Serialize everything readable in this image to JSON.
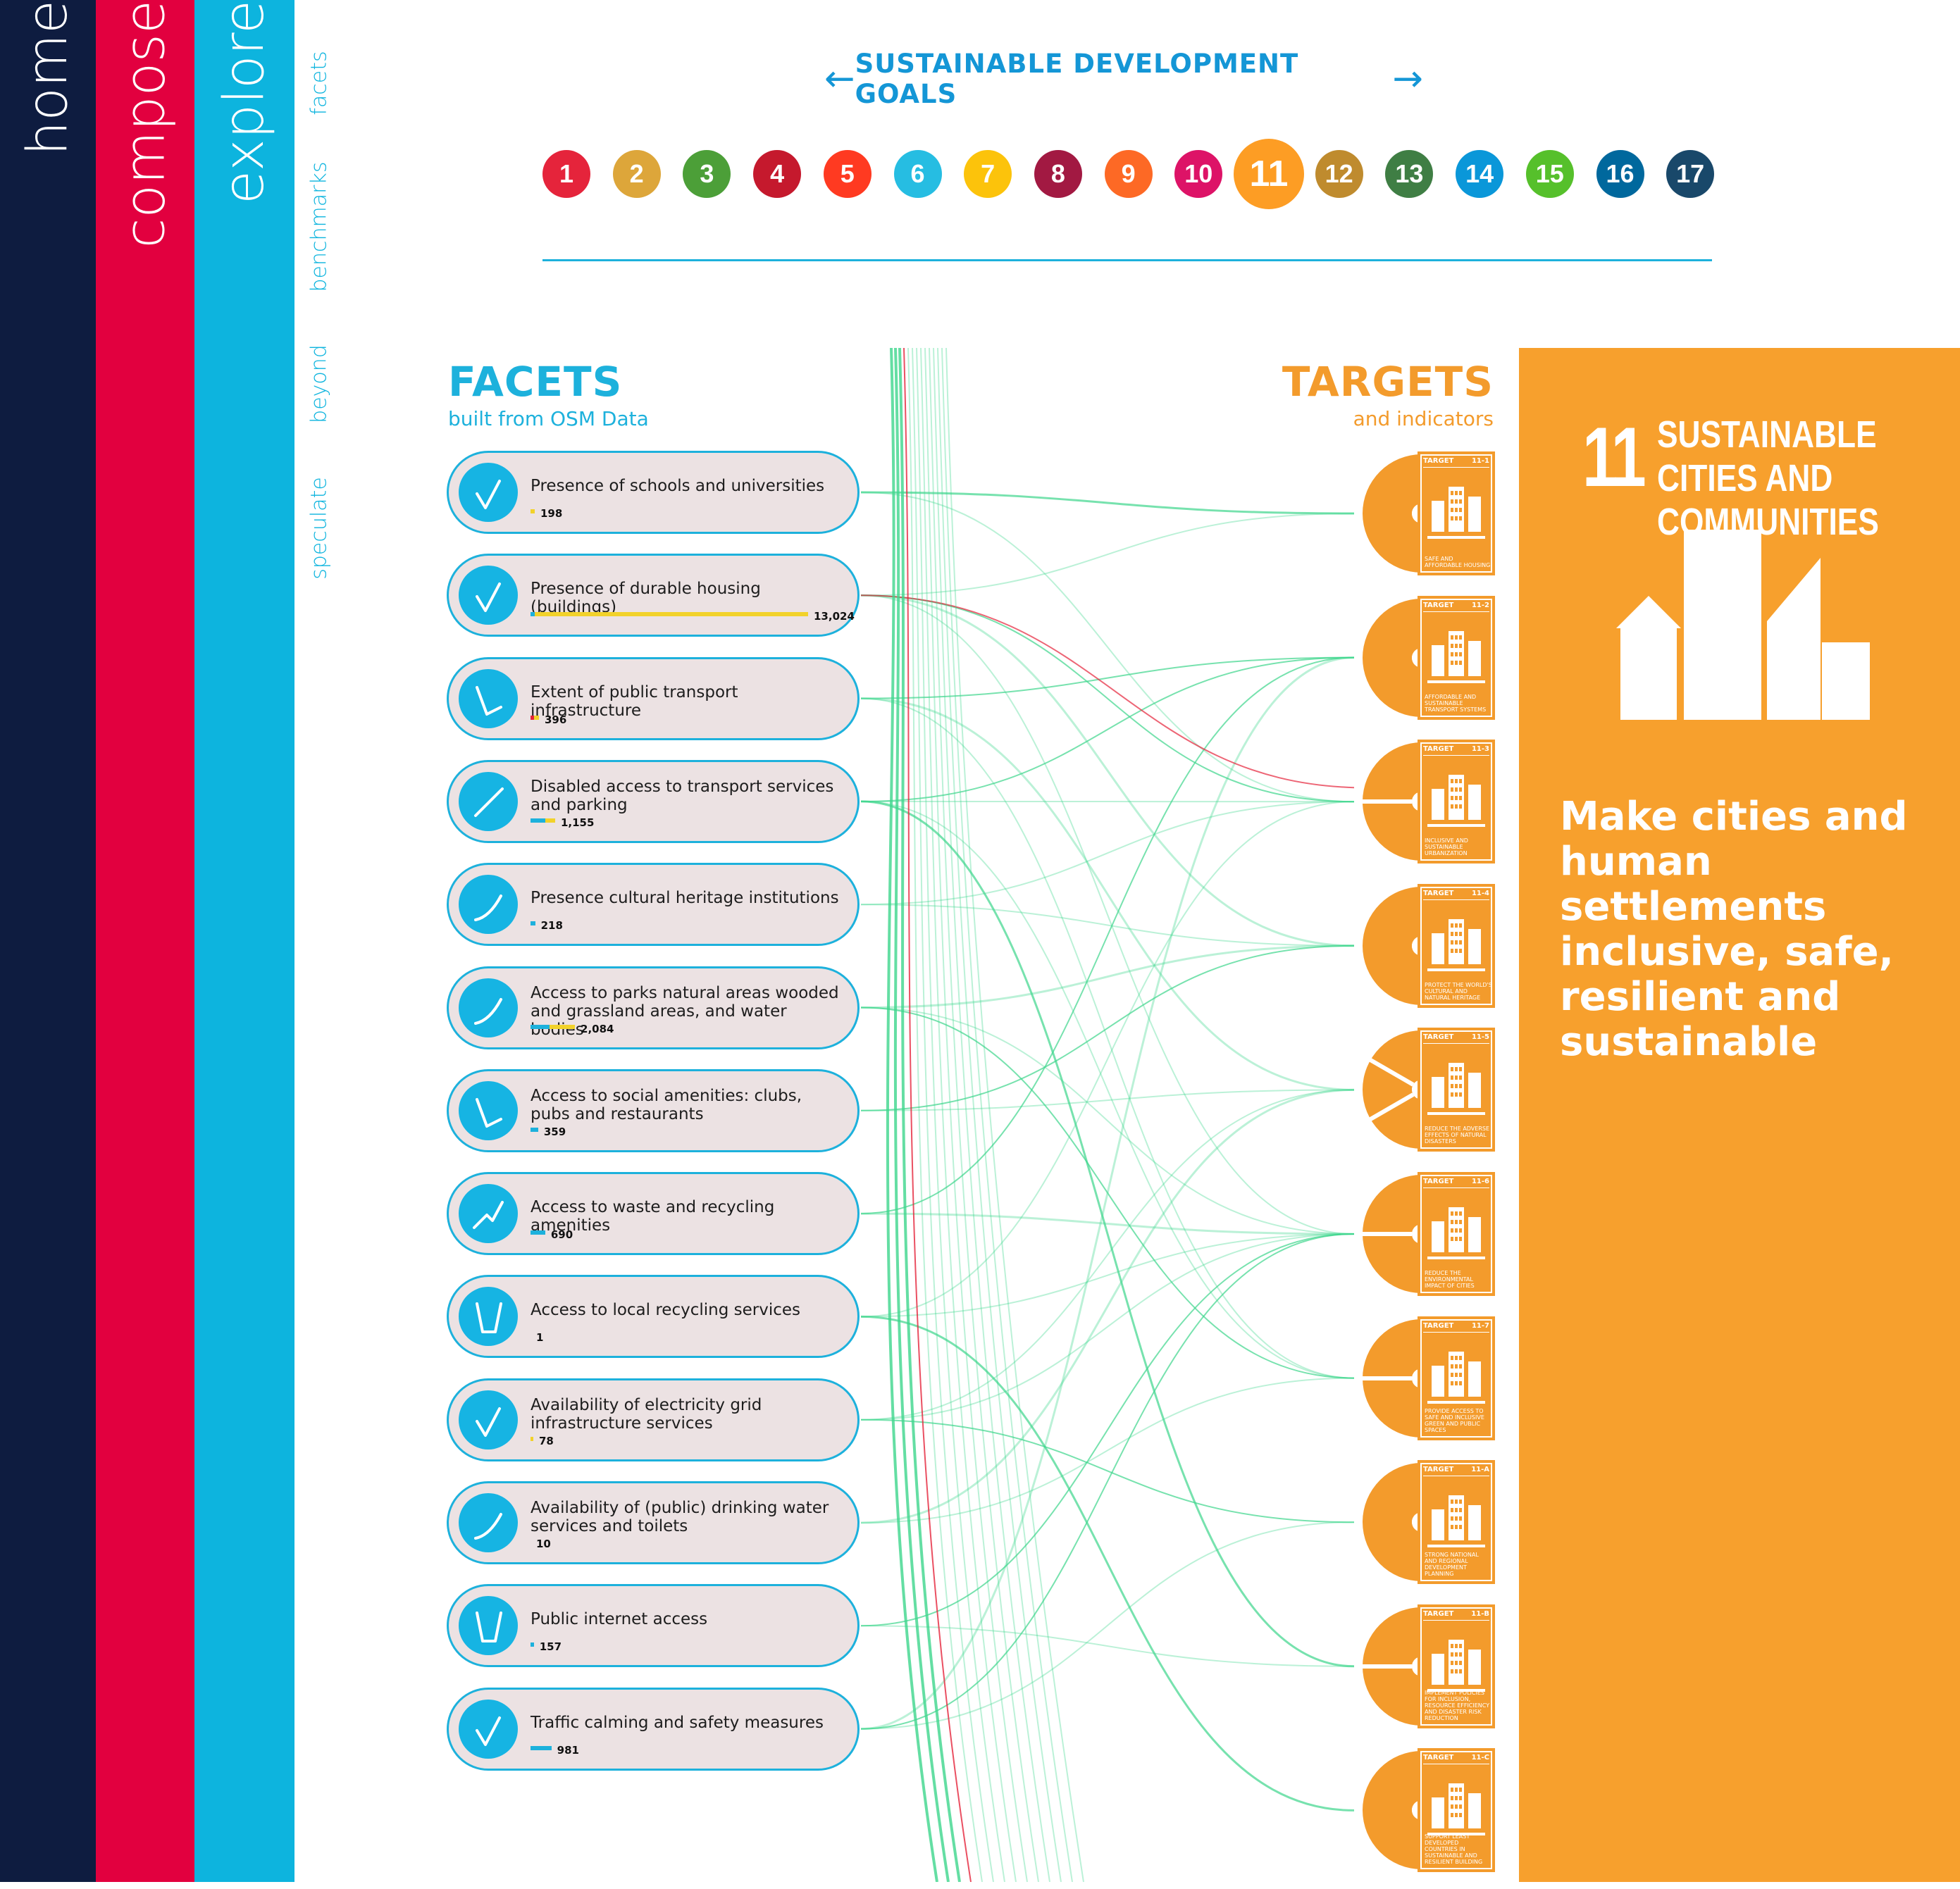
{
  "tabs": {
    "home": "home",
    "compose": "compose",
    "explore": "explore"
  },
  "subnav": [
    "facets",
    "benchmarks",
    "beyond",
    "speculate"
  ],
  "goals_nav": {
    "title": "SUSTAINABLE DEVELOPMENT GOALS",
    "prev_icon": "arrow-left-icon",
    "next_icon": "arrow-right-icon"
  },
  "sdgs": [
    {
      "num": "1",
      "color": "#e5243b"
    },
    {
      "num": "2",
      "color": "#dda63a"
    },
    {
      "num": "3",
      "color": "#4c9f38"
    },
    {
      "num": "4",
      "color": "#c5192d"
    },
    {
      "num": "5",
      "color": "#ff3a21"
    },
    {
      "num": "6",
      "color": "#26bde2"
    },
    {
      "num": "7",
      "color": "#fcc30b"
    },
    {
      "num": "8",
      "color": "#a21942"
    },
    {
      "num": "9",
      "color": "#fd6925"
    },
    {
      "num": "10",
      "color": "#dd1367"
    },
    {
      "num": "11",
      "color": "#fd9d24",
      "selected": true
    },
    {
      "num": "12",
      "color": "#bf8b2e"
    },
    {
      "num": "13",
      "color": "#3f7e44"
    },
    {
      "num": "14",
      "color": "#0a97d9"
    },
    {
      "num": "15",
      "color": "#56c02b"
    },
    {
      "num": "16",
      "color": "#00689d"
    },
    {
      "num": "17",
      "color": "#19486a"
    }
  ],
  "facets_section": {
    "title": "FACETS",
    "subtitle": "built from OSM Data"
  },
  "targets_section": {
    "title": "TARGETS",
    "subtitle": "and indicators"
  },
  "facets": [
    {
      "name": "Presence of schools and universities",
      "count": "198",
      "bars": [
        {
          "color": "#f2d22a",
          "value": 198
        }
      ],
      "trend": "check"
    },
    {
      "name": "Presence of durable housing (buildings)",
      "count": "13,024",
      "bars": [
        {
          "color": "#1db1dc",
          "value": 200
        },
        {
          "color": "#f2d22a",
          "value": 12824
        }
      ],
      "trend": "check"
    },
    {
      "name": "Extent of public transport infrastructure",
      "count": "396",
      "bars": [
        {
          "color": "#e5243b",
          "value": 150
        },
        {
          "color": "#f2d22a",
          "value": 246
        }
      ],
      "trend": "dip"
    },
    {
      "name": "Disabled access to transport services and parking",
      "count": "1,155",
      "bars": [
        {
          "color": "#1db1dc",
          "value": 700
        },
        {
          "color": "#f2d22a",
          "value": 455
        }
      ],
      "trend": "rise"
    },
    {
      "name": "Presence cultural heritage institutions",
      "count": "218",
      "bars": [
        {
          "color": "#1db1dc",
          "value": 218
        }
      ],
      "trend": "curve"
    },
    {
      "name": "Access to parks natural areas wooded and grassland areas, and water bodies",
      "count": "2,084",
      "bars": [
        {
          "color": "#1db1dc",
          "value": 900
        },
        {
          "color": "#f2d22a",
          "value": 1184
        }
      ],
      "trend": "curve"
    },
    {
      "name": "Access to social amenities: clubs, pubs and restaurants",
      "count": "359",
      "bars": [
        {
          "color": "#1db1dc",
          "value": 359
        }
      ],
      "trend": "dip"
    },
    {
      "name": "Access to waste and recycling amenities",
      "count": "690",
      "bars": [
        {
          "color": "#1db1dc",
          "value": 690
        }
      ],
      "trend": "step"
    },
    {
      "name": "Access to local recycling services",
      "count": "1",
      "bars": [],
      "trend": "cup"
    },
    {
      "name": "Availability of electricity grid infrastructure services",
      "count": "78",
      "bars": [
        {
          "color": "#f2d22a",
          "value": 78
        }
      ],
      "trend": "check"
    },
    {
      "name": "Availability of (public) drinking water services and toilets",
      "count": "10",
      "bars": [],
      "trend": "curve"
    },
    {
      "name": "Public internet access",
      "count": "157",
      "bars": [
        {
          "color": "#1db1dc",
          "value": 157
        }
      ],
      "trend": "cup"
    },
    {
      "name": "Traffic calming and safety measures",
      "count": "981",
      "bars": [
        {
          "color": "#1db1dc",
          "value": 981
        }
      ],
      "trend": "check"
    }
  ],
  "targets": [
    {
      "label": "TARGET",
      "id": "11-1",
      "caption": "SAFE AND AFFORDABLE HOUSING",
      "icon": "housing-icon",
      "segments": 1
    },
    {
      "label": "TARGET",
      "id": "11-2",
      "caption": "AFFORDABLE AND SUSTAINABLE TRANSPORT SYSTEMS",
      "icon": "transport-icon",
      "segments": 1
    },
    {
      "label": "TARGET",
      "id": "11-3",
      "caption": "INCLUSIVE AND SUSTAINABLE URBANIZATION",
      "icon": "urbanization-icon",
      "segments": 2
    },
    {
      "label": "TARGET",
      "id": "11-4",
      "caption": "PROTECT THE WORLD'S CULTURAL AND NATURAL HERITAGE",
      "icon": "heritage-icon",
      "segments": 1
    },
    {
      "label": "TARGET",
      "id": "11-5",
      "caption": "REDUCE THE ADVERSE EFFECTS OF NATURAL DISASTERS",
      "icon": "disaster-icon",
      "segments": 3
    },
    {
      "label": "TARGET",
      "id": "11-6",
      "caption": "REDUCE THE ENVIRONMENTAL IMPACT OF CITIES",
      "icon": "environment-icon",
      "segments": 2
    },
    {
      "label": "TARGET",
      "id": "11-7",
      "caption": "PROVIDE ACCESS TO SAFE AND INCLUSIVE GREEN AND PUBLIC SPACES",
      "icon": "green-space-icon",
      "segments": 2
    },
    {
      "label": "TARGET",
      "id": "11-A",
      "caption": "STRONG NATIONAL AND REGIONAL DEVELOPMENT PLANNING",
      "icon": "planning-icon",
      "segments": 1
    },
    {
      "label": "TARGET",
      "id": "11-B",
      "caption": "IMPLEMENT POLICIES FOR INCLUSION, RESOURCE EFFICIENCY AND DISASTER RISK REDUCTION",
      "icon": "policy-icon",
      "segments": 2
    },
    {
      "label": "TARGET",
      "id": "11-C",
      "caption": "SUPPORT LEAST DEVELOPED COUNTRIES IN SUSTAINABLE AND RESILIENT BUILDING",
      "icon": "building-support-icon",
      "segments": 1
    }
  ],
  "goal_panel": {
    "number": "11",
    "title": "SUSTAINABLE CITIES AND COMMUNITIES",
    "description": "Make cities and human settlements inclusive, safe, resilient and sustainable",
    "icon": "city-buildings-icon"
  },
  "colors": {
    "green_link": "#3dd68c",
    "red_link": "#e5243b",
    "accent_blue": "#1db1dc",
    "goal_orange": "#f7a02d"
  }
}
